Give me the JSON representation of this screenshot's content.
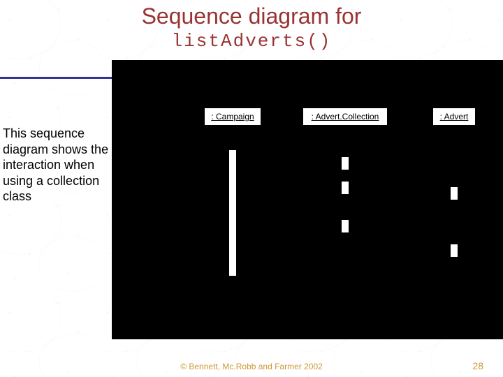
{
  "title": "Sequence diagram for",
  "subtitle": "listAdverts()",
  "sideText": "This sequence diagram shows the interaction when using a collection class",
  "objects": {
    "campaign": ": Campaign",
    "advertCollection": ": Advert.Collection",
    "advert": ": Advert"
  },
  "footer": {
    "copyright": "© Bennett, Mc.Robb and Farmer 2002",
    "page": "28"
  },
  "chart_data": {
    "type": "sequence-diagram",
    "lifelines": [
      {
        "name": ": Campaign"
      },
      {
        "name": ": Advert.Collection"
      },
      {
        "name": ": Advert"
      }
    ],
    "activations": [
      {
        "lifeline": ": Campaign",
        "segments": 1
      },
      {
        "lifeline": ": Advert.Collection",
        "segments": 3
      },
      {
        "lifeline": ": Advert",
        "segments": 2
      }
    ],
    "note": "Interaction when using a collection class; message labels not visible in source image"
  }
}
